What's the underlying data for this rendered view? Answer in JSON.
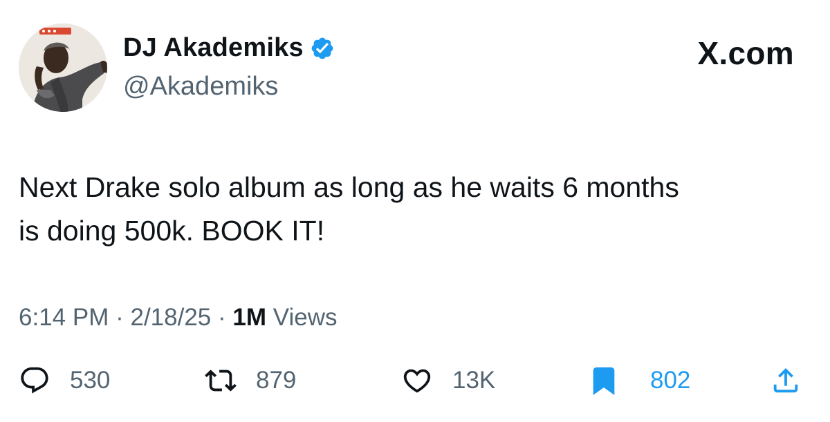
{
  "author": {
    "display_name": "DJ Akademiks",
    "handle": "@Akademiks",
    "verified": true,
    "avatar_icon": "profile-photo",
    "verified_icon": "verified-badge-icon"
  },
  "brand": {
    "label": "X.com"
  },
  "tweet": {
    "line1": "Next Drake solo album as long as he waits 6 months",
    "line2": "is doing 500k. BOOK IT!"
  },
  "meta": {
    "time": "6:14 PM",
    "date": "2/18/25",
    "separator": "·",
    "views_count": "1M",
    "views_label": "Views"
  },
  "actions": {
    "replies": "530",
    "reposts": "879",
    "likes": "13K",
    "bookmarks": "802"
  },
  "colors": {
    "text_primary": "#0f1419",
    "text_secondary": "#536471",
    "accent_blue": "#1d9bf0"
  }
}
